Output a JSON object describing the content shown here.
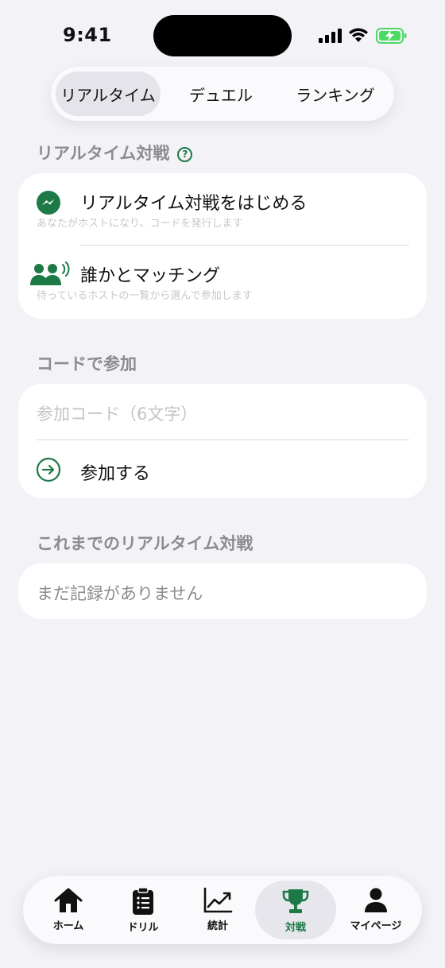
{
  "status_bar": {
    "time": "9:41"
  },
  "segments": [
    "リアルタイム",
    "デュエル",
    "ランキング"
  ],
  "realtime": {
    "section_title": "リアルタイム対戦",
    "start": {
      "title": "リアルタイム対戦をはじめる",
      "subtitle": "あなたがホストになり、コードを発行します"
    },
    "match": {
      "title": "誰かとマッチング",
      "subtitle": "待っているホストの一覧から選んで参加します"
    }
  },
  "join": {
    "section_title": "コードで参加",
    "code_placeholder": "参加コード（6文字）",
    "join_label": "参加する"
  },
  "history": {
    "section_title": "これまでのリアルタイム対戦",
    "empty_text": "まだ記録がありません"
  },
  "tab_bar": {
    "items": [
      "ホーム",
      "ドリル",
      "統計",
      "対戦",
      "マイページ"
    ],
    "active": "対戦"
  },
  "colors": {
    "accent": "#1d7a46",
    "background": "#f2f2f7"
  }
}
